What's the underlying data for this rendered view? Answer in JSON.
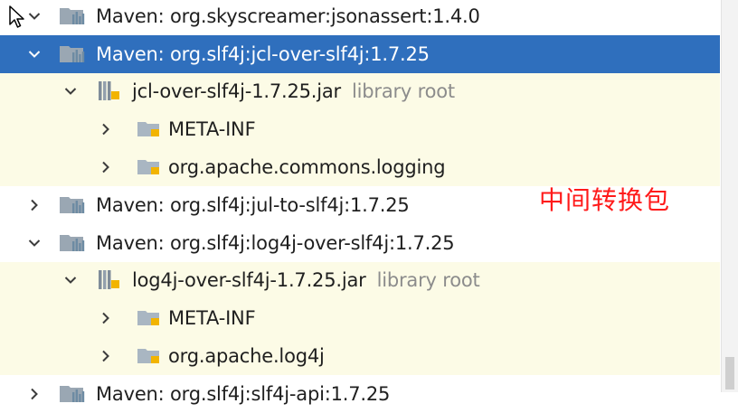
{
  "tree": [
    {
      "level": 1,
      "expanded": true,
      "icon": "maven-library-icon",
      "label": "Maven: org.skyscreamer:jsonassert:1.4.0",
      "bg": "plain"
    },
    {
      "level": 1,
      "expanded": true,
      "icon": "maven-library-icon",
      "label": "Maven: org.slf4j:jcl-over-slf4j:1.7.25",
      "bg": "selected"
    },
    {
      "level": 2,
      "expanded": true,
      "icon": "jar-icon",
      "label": "jcl-over-slf4j-1.7.25.jar",
      "suffix": "library root",
      "bg": "lib"
    },
    {
      "level": 3,
      "expanded": false,
      "icon": "package-folder-icon",
      "label": "META-INF",
      "bg": "lib"
    },
    {
      "level": 3,
      "expanded": false,
      "icon": "package-folder-icon",
      "label": "org.apache.commons.logging",
      "bg": "lib"
    },
    {
      "level": 1,
      "expanded": false,
      "icon": "maven-library-icon",
      "label": "Maven: org.slf4j:jul-to-slf4j:1.7.25",
      "bg": "plain"
    },
    {
      "level": 1,
      "expanded": true,
      "icon": "maven-library-icon",
      "label": "Maven: org.slf4j:log4j-over-slf4j:1.7.25",
      "bg": "plain"
    },
    {
      "level": 2,
      "expanded": true,
      "icon": "jar-icon",
      "label": "log4j-over-slf4j-1.7.25.jar",
      "suffix": "library root",
      "bg": "lib"
    },
    {
      "level": 3,
      "expanded": false,
      "icon": "package-folder-icon",
      "label": "META-INF",
      "bg": "lib"
    },
    {
      "level": 3,
      "expanded": false,
      "icon": "package-folder-icon",
      "label": "org.apache.log4j",
      "bg": "lib"
    },
    {
      "level": 1,
      "expanded": false,
      "icon": "maven-library-icon",
      "label": "Maven: org.slf4j:slf4j-api:1.7.25",
      "bg": "plain"
    }
  ],
  "annotation": "中间转换包",
  "colors": {
    "selection": "#2f6fbd",
    "library_bg": "#fcfbe6",
    "annotation": "#ff1a1a",
    "suffix": "#8c8c8c"
  }
}
